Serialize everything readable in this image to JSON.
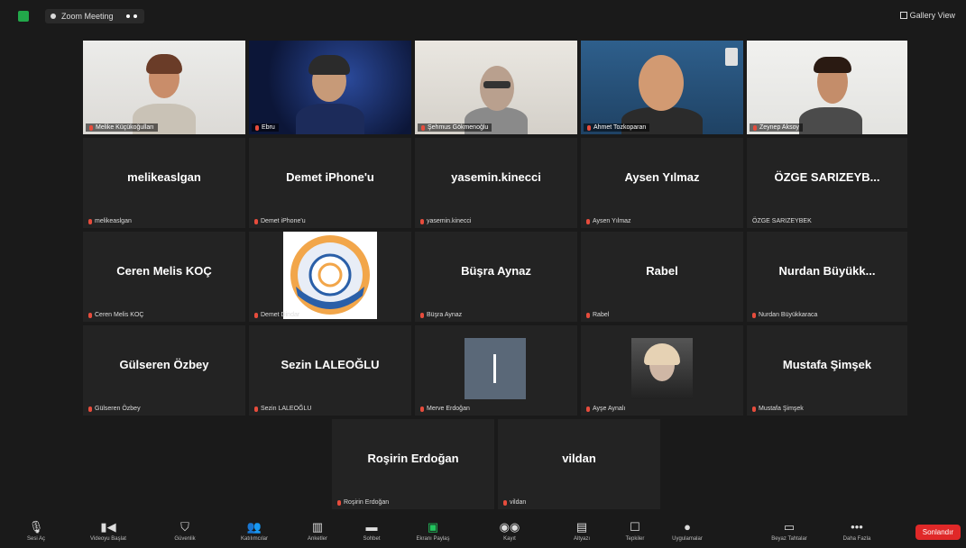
{
  "topbar": {
    "meeting_title": "Zoom Meeting",
    "view_label": "Gallery View"
  },
  "video_tiles": [
    {
      "label": "Melike Küçükoğulları"
    },
    {
      "label": "Ebru"
    },
    {
      "label": "Şehmus Gökmenoğlu"
    },
    {
      "label": "Ahmet Tozkoparan"
    },
    {
      "label": "Zeynep Aksoy"
    }
  ],
  "name_tiles": [
    {
      "name": "melikeaslgan",
      "label": "melikeaslgan"
    },
    {
      "name": "Demet iPhone'u",
      "label": "Demet iPhone'u"
    },
    {
      "name": "yasemin.kinecci",
      "label": "yasemin.kinecci"
    },
    {
      "name": "Aysen Yılmaz",
      "label": "Aysen Yılmaz"
    },
    {
      "name": "ÖZGE SARIZEYB...",
      "label": "ÖZGE SARIZEYBEK"
    },
    {
      "name": "Ceren Melis KOÇ",
      "label": "Ceren Melis KOÇ"
    },
    {
      "name": "Büşra Aynaz",
      "label": "Büşra Aynaz"
    },
    {
      "name": "Rabel",
      "label": "Rabel"
    },
    {
      "name": "Nurdan Büyükk...",
      "label": "Nurdan Büyükkaraca"
    },
    {
      "name": "Gülseren Özbey",
      "label": "Gülseren Özbey"
    },
    {
      "name": "Sezin LALEOĞLU",
      "label": "Sezin LALEOĞLU"
    },
    {
      "name": "Mustafa Şimşek",
      "label": "Mustafa Şimşek"
    },
    {
      "name": "Roşirin Erdoğan",
      "label": "Roşirin Erdoğan"
    },
    {
      "name": "vildan",
      "label": "vildan"
    }
  ],
  "image_tiles": [
    {
      "label": "Demet Dindar"
    },
    {
      "label": "Merve Erdoğan"
    },
    {
      "label": "Ayşe Aynalı"
    }
  ],
  "toolbar": {
    "items": [
      "Sesi Aç",
      "Videoyu Başlat",
      "Güvenlik",
      "Katılımcılar",
      "Anketler",
      "Sohbet",
      "Ekranı Paylaş",
      "Kayıt",
      "Altyazı",
      "Tepkiler",
      "Uygulamalar",
      "Beyaz Tahtalar",
      "Daha Fazla"
    ],
    "end_label": "Sonlandır"
  },
  "colors": {
    "background": "#1a1a1a",
    "tile": "#232323",
    "active_speaker": "#a8d26b",
    "end": "#e02828",
    "share": "#22c55e",
    "mic_muted": "#e74c3c"
  }
}
